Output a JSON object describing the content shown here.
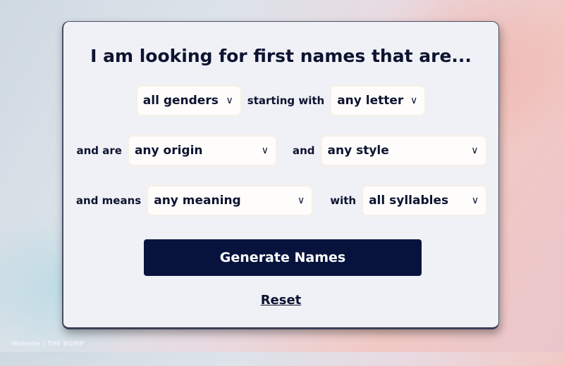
{
  "title": "I am looking for first names that are...",
  "row1": {
    "gender": {
      "value": "all genders"
    },
    "starting_label": "starting with",
    "letter": {
      "value": "any letter"
    }
  },
  "row2": {
    "origin_label": "and are",
    "origin": {
      "value": "any origin"
    },
    "style_label": "and",
    "style": {
      "value": "any style"
    }
  },
  "row3": {
    "meaning_label": "and means",
    "meaning": {
      "value": "any meaning"
    },
    "syllables_label": "with",
    "syllables": {
      "value": "all syllables"
    }
  },
  "chevron_glyph": "∨",
  "generate_label": "Generate Names",
  "reset_label": "Reset",
  "watermark": "Website | THE BUMP",
  "colors": {
    "primary": "#07133d",
    "card": "#eff1f6",
    "text": "#0d1330"
  }
}
